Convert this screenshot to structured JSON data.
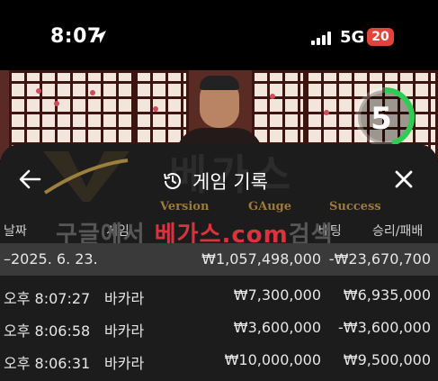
{
  "status_bar": {
    "time": "8:07",
    "network": "5G",
    "battery": "20"
  },
  "video": {
    "timer": "5"
  },
  "panel": {
    "title": "게임 기록"
  },
  "watermark": {
    "brand": "베가스",
    "tags": [
      "Version",
      "GAuge",
      "Success"
    ],
    "search_prefix": "구글에서 ",
    "search_site": "베가스.com",
    "search_suffix": "검색"
  },
  "table": {
    "columns": [
      "날짜",
      "게임",
      "베팅",
      "승리/패배"
    ],
    "summary": {
      "date": "–2025. 6. 23.",
      "bet": "₩1,057,498,000",
      "result": "-₩23,670,700"
    },
    "rows": [
      {
        "time": "오후 8:07:27",
        "game": "바카라",
        "bet": "₩7,300,000",
        "result": "₩6,935,000"
      },
      {
        "time": "오후 8:06:58",
        "game": "바카라",
        "bet": "₩3,600,000",
        "result": "-₩3,600,000"
      },
      {
        "time": "오후 8:06:31",
        "game": "바카라",
        "bet": "₩10,000,000",
        "result": "₩9,500,000"
      }
    ]
  }
}
